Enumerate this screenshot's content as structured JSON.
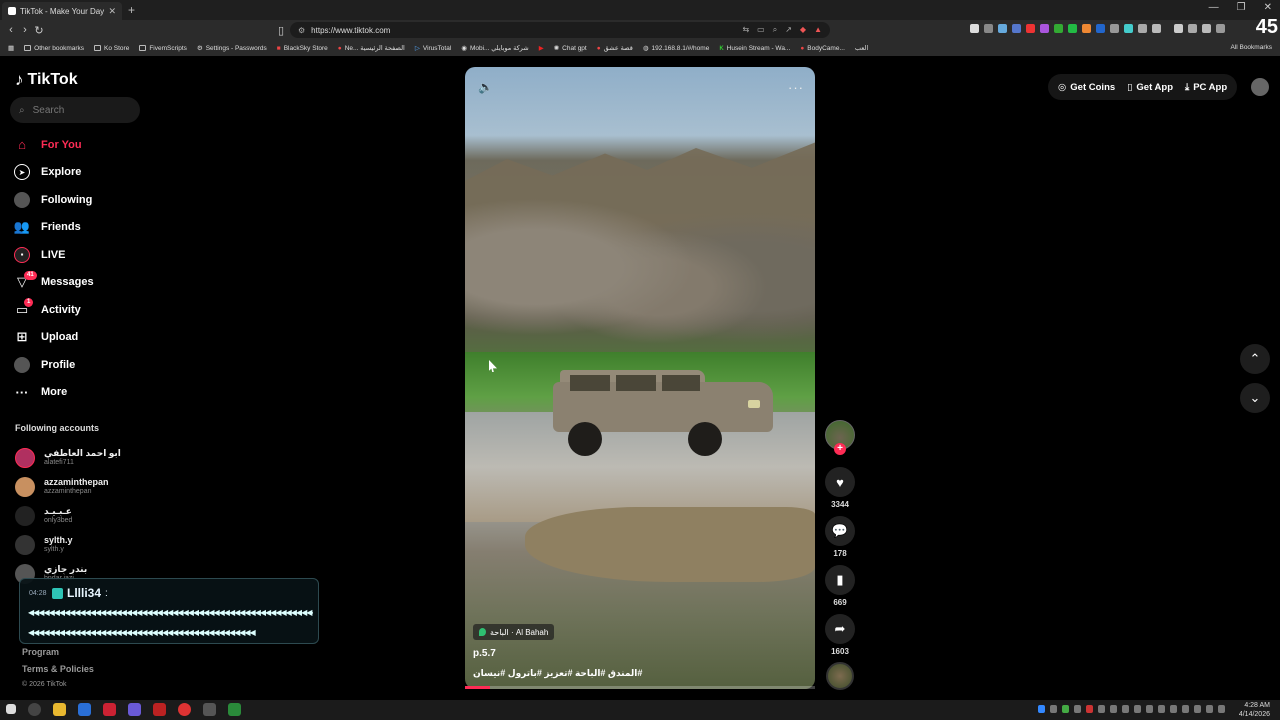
{
  "browser": {
    "tab_title": "TikTok - Make Your Day",
    "url": "https://www.tiktok.com",
    "counter": "45",
    "bookmarks": [
      "Other bookmarks",
      "Ko Store",
      "FivemScripts",
      "Settings - Passwords",
      "BlackSky Store",
      "Ne... الصفحة الرئيسية",
      "VirusTotal",
      "Mobi... شركة موبايلي",
      "Chat gpt",
      "قصة عشق",
      "192.168.8.1/#/home",
      "Husein Stream - Wa...",
      "BodyCame...",
      "العب"
    ],
    "all_bookmarks": "All Bookmarks"
  },
  "sidebar": {
    "logo": "TikTok",
    "search_placeholder": "Search",
    "nav": [
      {
        "label": "For You",
        "icon": "home-icon"
      },
      {
        "label": "Explore",
        "icon": "compass-icon"
      },
      {
        "label": "Following",
        "icon": "following-avatar-icon"
      },
      {
        "label": "Friends",
        "icon": "friends-icon"
      },
      {
        "label": "LIVE",
        "icon": "live-icon"
      },
      {
        "label": "Messages",
        "icon": "messages-icon",
        "badge": "41"
      },
      {
        "label": "Activity",
        "icon": "activity-icon",
        "badge": "1"
      },
      {
        "label": "Upload",
        "icon": "upload-icon"
      },
      {
        "label": "Profile",
        "icon": "profile-avatar-icon"
      },
      {
        "label": "More",
        "icon": "more-icon"
      }
    ],
    "following_title": "Following accounts",
    "following": [
      {
        "name": "ابو احمد العاطفي",
        "handle": "alatefi711"
      },
      {
        "name": "azzaminthepan",
        "handle": "azzaminthepan"
      },
      {
        "name": "عـبـيـد",
        "handle": "only3bed"
      },
      {
        "name": "sylth.y",
        "handle": "sylth.y"
      },
      {
        "name": "بندر جازي",
        "handle": "bndar.jazi"
      }
    ],
    "footer": [
      "Program",
      "Terms & Policies"
    ],
    "copyright": "© 2026 TikTok"
  },
  "overlay": {
    "time": "04:28",
    "user": "Lllli34",
    "separator": ":",
    "line1": "◀◀◀◀◀◀◀◀◀◀◀◀◀◀◀◀◀◀◀◀◀◀◀◀◀◀◀◀◀◀◀◀◀◀◀◀◀◀◀◀◀◀◀◀◀◀◀◀◀◀◀◀◀◀◀◀",
    "line2": "◀◀◀◀◀◀◀◀◀◀◀◀◀◀◀◀◀◀◀◀◀◀◀◀◀◀◀◀◀◀◀◀◀◀◀◀◀◀◀◀◀◀◀◀"
  },
  "video": {
    "location": "الباحة · Al Bahah",
    "title": "p.5.7",
    "tags": "#المندق #الباحة #تعزيز #باترول #نيسان",
    "progress": 0.07
  },
  "actions": {
    "likes": "3344",
    "comments": "178",
    "saves": "669",
    "shares": "1603"
  },
  "topbar": {
    "get_coins": "Get Coins",
    "get_app": "Get App",
    "pc_app": "PC App"
  },
  "taskbar": {
    "time": "4:28 AM",
    "date": "4/14/2026"
  }
}
